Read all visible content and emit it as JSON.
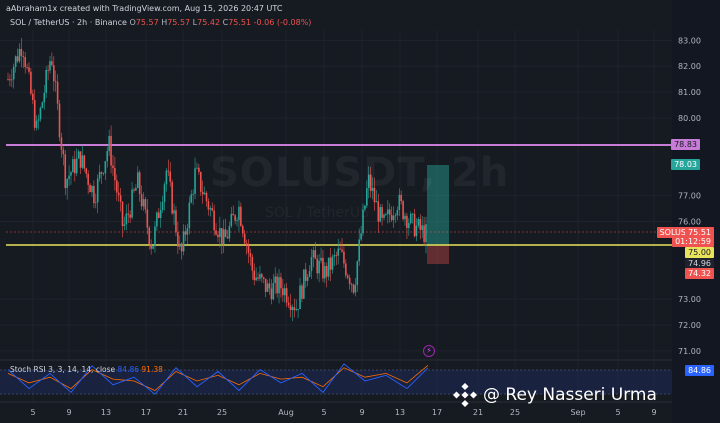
{
  "header": {
    "credit": "aAbraham1x created with TradingView.com, Aug 15, 2026 20:47 UTC",
    "symbol": "SOL / TetherUS · 2h · Binance",
    "o_label": "O",
    "o_value": "75.57",
    "h_label": "H",
    "h_value": "75.57",
    "l_label": "L",
    "l_value": "75.42",
    "c_label": "C",
    "c_value": "75.51",
    "change": "-0.06 (-0.08%)"
  },
  "watermark": {
    "ticker": "SOLUSDT, 2h",
    "name": "SOL / TetherUS"
  },
  "price_axis": [
    "83.00",
    "82.00",
    "81.00",
    "80.00",
    "77.00",
    "76.00",
    "73.00",
    "72.00",
    "71.00"
  ],
  "tags": {
    "resistance": "78.83",
    "top": "78.03",
    "symbol": "SOLUSDT",
    "price": "75.51",
    "countdown": "01:12:59",
    "support": "75.00",
    "stop1": "74.96",
    "stop2": "74.32",
    "rsi": "84.86"
  },
  "time_axis": [
    "5",
    "9",
    "13",
    "17",
    "21",
    "25",
    "Aug",
    "5",
    "9",
    "13",
    "17",
    "21",
    "25",
    "Sep",
    "5",
    "9"
  ],
  "rsi": {
    "legend": "Stoch RSI 3, 3, 14, 14, close",
    "k": "84.86",
    "d": "91.38"
  },
  "overlay": {
    "credit_text": "@ Rey Nasseri Urma"
  },
  "colors": {
    "background": "#161a21",
    "resistance_line": "#c77dd8",
    "support_line": "#e8e35a",
    "bull": "#26a69a",
    "bear": "#ef5350",
    "rsi_k": "#2962ff",
    "rsi_d": "#ff6d00"
  },
  "chart_data": {
    "type": "line",
    "title": "SOL / TetherUS · 2h · Binance",
    "ylim": [
      70.8,
      83.4
    ],
    "horizontal_levels": [
      {
        "label": "78.83",
        "value": 78.83
      },
      {
        "label": "75.00",
        "value": 75.0
      }
    ],
    "x": [
      "5",
      "9",
      "13",
      "17",
      "21",
      "25",
      "Aug",
      "5",
      "9",
      "13",
      "17"
    ],
    "close_path": [
      81.5,
      82.9,
      79.5,
      82.5,
      77.6,
      78.5,
      77.0,
      79.0,
      75.7,
      77.5,
      75.0,
      78.0,
      74.6,
      77.9,
      76.5,
      75.2,
      76.6,
      74.0,
      73.4,
      73.5,
      72.7,
      74.6,
      74.0,
      74.8,
      73.5,
      77.6,
      75.8,
      76.8,
      75.9,
      75.51
    ],
    "stoch_rsi_k": [
      80,
      30,
      70,
      20,
      90,
      40,
      60,
      15,
      85,
      35,
      75,
      25,
      80,
      45,
      70,
      20,
      95,
      50,
      65,
      30,
      84.86
    ],
    "stoch_rsi_d": [
      70,
      45,
      60,
      30,
      80,
      55,
      50,
      25,
      75,
      50,
      65,
      40,
      70,
      55,
      60,
      35,
      85,
      60,
      70,
      45,
      91.38
    ]
  }
}
